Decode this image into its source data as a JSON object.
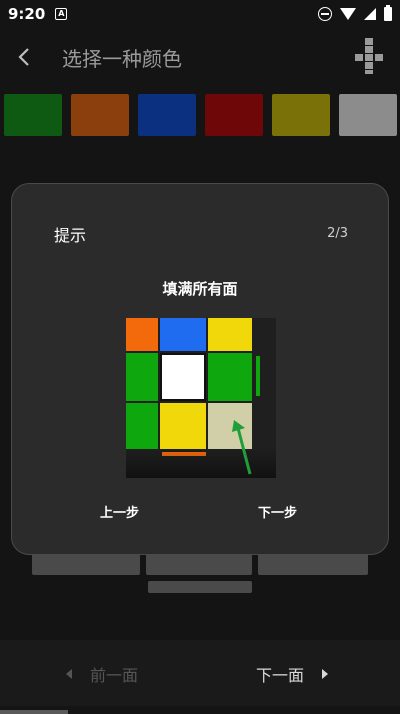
{
  "status_bar": {
    "time": "9:20",
    "notification_letter": "A"
  },
  "app_bar": {
    "title": "选择一种颜色"
  },
  "swatches": [
    {
      "name": "green",
      "color": "#0f5a12"
    },
    {
      "name": "orange",
      "color": "#8a3f0d"
    },
    {
      "name": "blue",
      "color": "#0b3080"
    },
    {
      "name": "red",
      "color": "#6e0808"
    },
    {
      "name": "yellow",
      "color": "#7a7209"
    },
    {
      "name": "white",
      "color": "#8c8c8c"
    }
  ],
  "dialog": {
    "title": "提示",
    "page_indicator": "2/3",
    "subtitle": "填满所有面",
    "prev_button": "上一步",
    "next_button": "下一步",
    "cube_colors": {
      "orange": "#f26a0c",
      "blue": "#1f6cf0",
      "yellow": "#f0d80a",
      "green": "#0ea80e",
      "white": "#ffffff",
      "beige": "#d1cfa8",
      "arrow": "#1f9e3a"
    }
  },
  "bottom_nav": {
    "prev_face": "前一面",
    "next_face": "下一面"
  }
}
